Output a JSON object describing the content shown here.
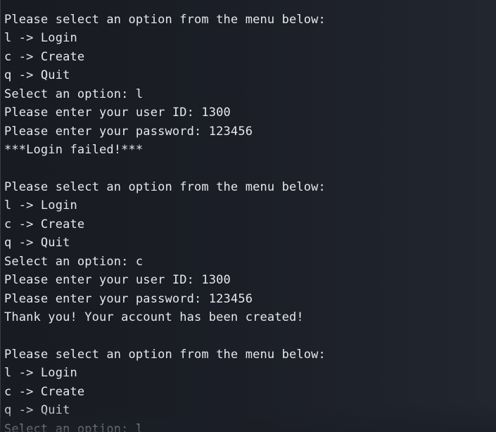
{
  "terminal": {
    "lines": [
      "Please select an option from the menu below:",
      "l -> Login",
      "c -> Create",
      "q -> Quit",
      "Select an option: l",
      "Please enter your user ID: 1300",
      "Please enter your password: 123456",
      "***Login failed!***",
      "",
      "Please select an option from the menu below:",
      "l -> Login",
      "c -> Create",
      "q -> Quit",
      "Select an option: c",
      "Please enter your user ID: 1300",
      "Please enter your password: 123456",
      "Thank you! Your account has been created!",
      "",
      "Please select an option from the menu below:",
      "l -> Login",
      "c -> Create",
      "q -> Quit",
      "Select an option: l"
    ]
  },
  "colors": {
    "background": "#1b1e26",
    "text": "#e6e8ec"
  }
}
